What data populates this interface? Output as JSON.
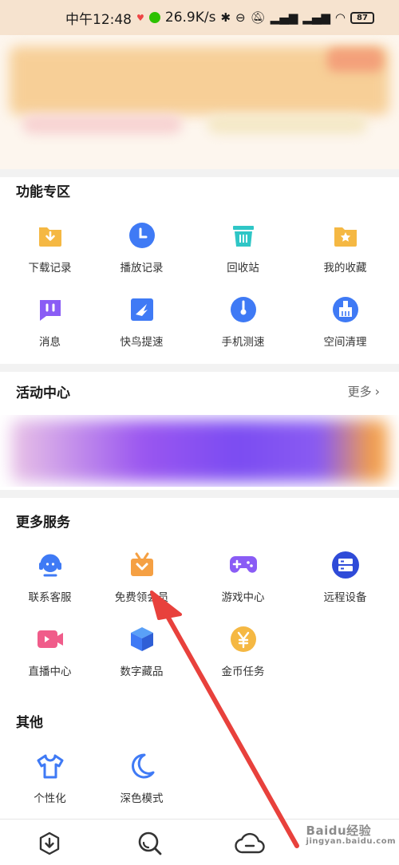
{
  "status_bar": {
    "time": "中午12:48",
    "net_speed": "26.9K/s",
    "battery": "87"
  },
  "sections": {
    "features": {
      "title": "功能专区",
      "items": [
        {
          "label": "下载记录",
          "icon": "download-folder-icon"
        },
        {
          "label": "播放记录",
          "icon": "clock-icon"
        },
        {
          "label": "回收站",
          "icon": "trash-icon"
        },
        {
          "label": "我的收藏",
          "icon": "star-folder-icon"
        },
        {
          "label": "消息",
          "icon": "message-icon"
        },
        {
          "label": "快鸟提速",
          "icon": "bird-icon"
        },
        {
          "label": "手机测速",
          "icon": "speedometer-icon"
        },
        {
          "label": "空间清理",
          "icon": "broom-icon"
        }
      ]
    },
    "activity": {
      "title": "活动中心",
      "more": "更多"
    },
    "services": {
      "title": "更多服务",
      "items": [
        {
          "label": "联系客服",
          "icon": "headset-icon"
        },
        {
          "label": "免费领会员",
          "icon": "gift-icon"
        },
        {
          "label": "游戏中心",
          "icon": "gamepad-icon"
        },
        {
          "label": "远程设备",
          "icon": "server-icon"
        },
        {
          "label": "直播中心",
          "icon": "video-camera-icon"
        },
        {
          "label": "数字藏品",
          "icon": "cube-icon"
        },
        {
          "label": "金币任务",
          "icon": "yen-coin-icon"
        }
      ]
    },
    "other": {
      "title": "其他",
      "items": [
        {
          "label": "个性化",
          "icon": "tshirt-icon"
        },
        {
          "label": "深色模式",
          "icon": "moon-icon"
        }
      ]
    }
  },
  "bottom_nav": [
    {
      "icon": "download-nav-icon"
    },
    {
      "icon": "search-nav-icon"
    },
    {
      "icon": "cloud-nav-icon"
    }
  ],
  "watermark": {
    "text": "Baidu经验",
    "sub": "jingyan.baidu.com"
  },
  "colors": {
    "blue": "#3f7af5",
    "orange": "#f5b843",
    "teal": "#2fc6c6",
    "purple": "#8a5cf5",
    "pink": "#f05c8a",
    "arrow_red": "#e8413c"
  }
}
